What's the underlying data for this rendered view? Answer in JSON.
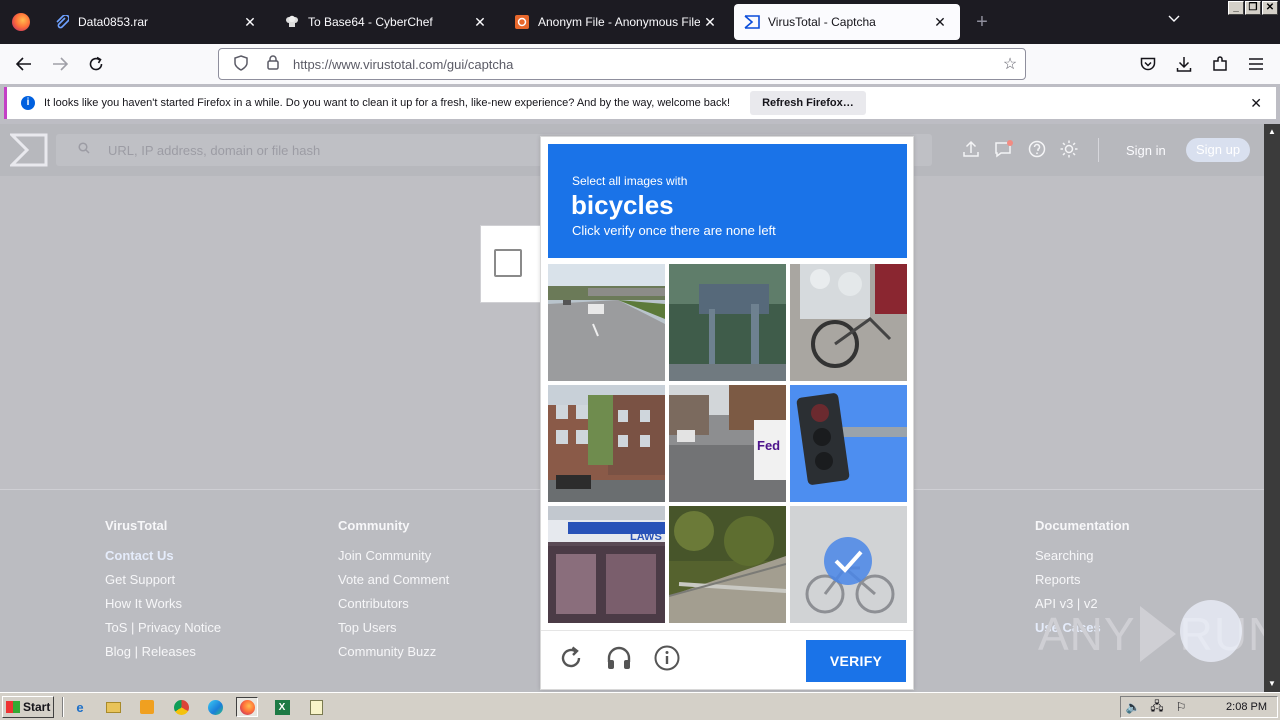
{
  "browser": {
    "tabs": [
      {
        "title": "Data0853.rar",
        "active": false
      },
      {
        "title": "To Base64 - CyberChef",
        "active": false
      },
      {
        "title": "Anonym File - Anonymous File Uplo",
        "active": false
      },
      {
        "title": "VirusTotal - Captcha",
        "active": true
      }
    ],
    "new_tab": "+",
    "url": "https://www.virustotal.com/gui/captcha"
  },
  "notification": {
    "message": "It looks like you haven't started Firefox in a while. Do you want to clean it up for a fresh, like-new experience? And by the way, welcome back!",
    "button": "Refresh Firefox…"
  },
  "virustotal": {
    "search_placeholder": "URL, IP address, domain or file hash",
    "sign_in": "Sign in",
    "sign_up": "Sign up",
    "footer": {
      "virustotal": {
        "heading": "VirusTotal",
        "links": [
          "Contact Us",
          "Get Support",
          "How It Works",
          "ToS | Privacy Notice",
          "Blog | Releases"
        ]
      },
      "community": {
        "heading": "Community",
        "links": [
          "Join Community",
          "Vote and Comment",
          "Contributors",
          "Top Users",
          "Community Buzz"
        ]
      },
      "documentation": {
        "heading": "Documentation",
        "links": [
          "Searching",
          "Reports",
          "API v3 | v2",
          "Use Cases"
        ]
      }
    }
  },
  "captcha": {
    "prompt_line1": "Select all images with",
    "target": "bicycles",
    "prompt_line3": "Click verify once there are none left",
    "verify_label": "VERIFY",
    "selected_tiles": [
      8
    ],
    "brand_color": "#1a73e8"
  },
  "watermark": {
    "text_left": "ANY",
    "text_right": "RUN"
  },
  "taskbar": {
    "start_label": "Start",
    "clock": "2:08 PM"
  }
}
